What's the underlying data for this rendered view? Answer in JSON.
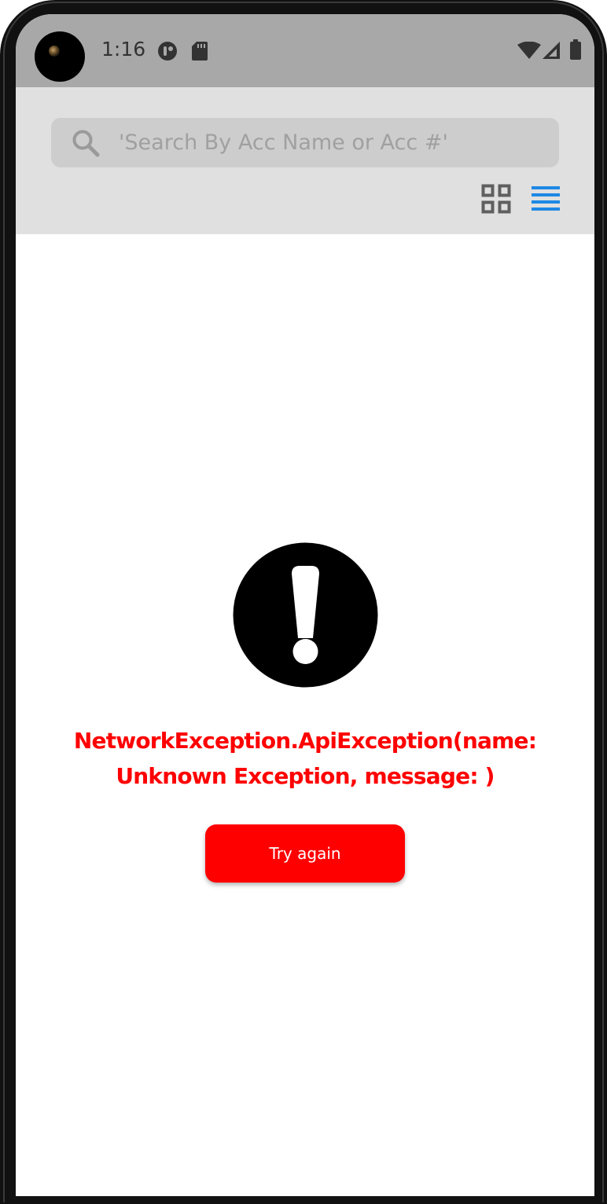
{
  "status_bar": {
    "time": "1:16",
    "icons": [
      "app-notification-icon",
      "sd-card-icon",
      "wifi-icon",
      "cell-signal-icon",
      "battery-icon"
    ]
  },
  "search": {
    "placeholder": "'Search By Acc Name or Acc #'",
    "value": ""
  },
  "view_toggle": {
    "grid_icon": "grid-view-icon",
    "list_icon": "list-view-icon",
    "active": "list",
    "active_color": "#1e88e5",
    "inactive_color": "#5f5f5f"
  },
  "error": {
    "icon": "exclamation-circle-icon",
    "message": "NetworkException.ApiException(name: Unknown Exception, message: )",
    "color": "#ff0000"
  },
  "retry_button": {
    "label": "Try again",
    "color": "#ff0000"
  }
}
